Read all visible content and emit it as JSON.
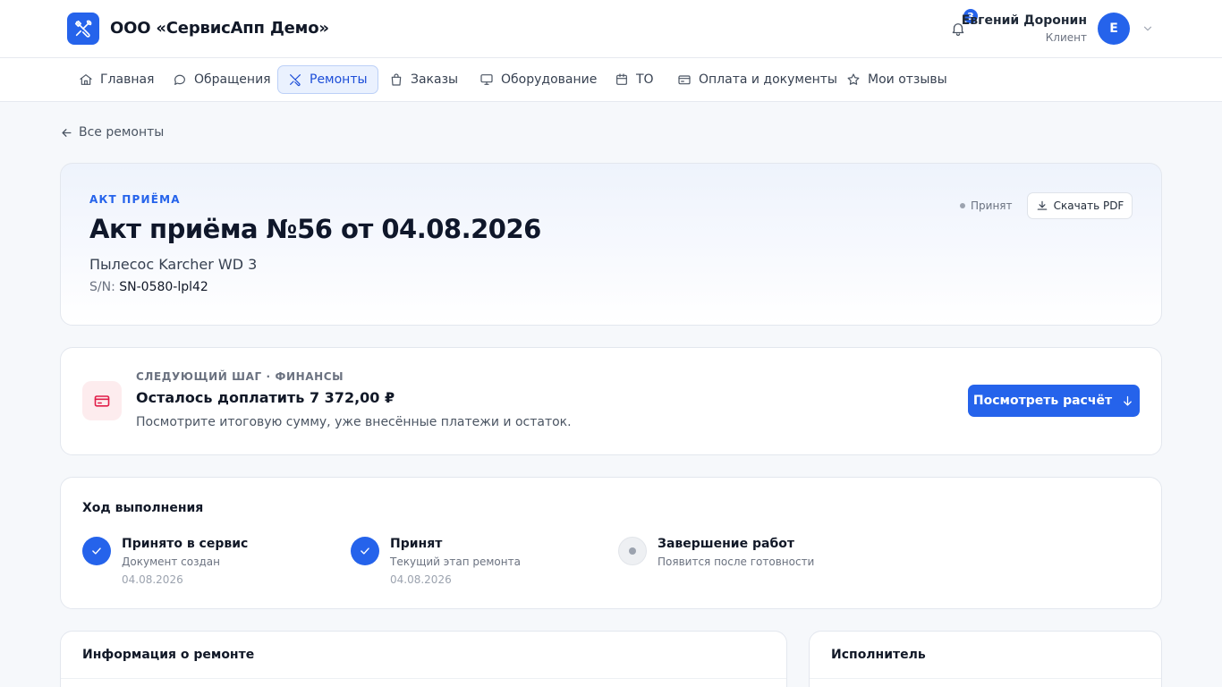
{
  "header": {
    "company": "ООО «СервисАпп Демо»",
    "notifications_count": "3",
    "user_name": "Евгений Доронин",
    "user_role": "Клиент",
    "avatar_letter": "E"
  },
  "nav": {
    "items": [
      {
        "label": "Главная",
        "icon": "home-icon"
      },
      {
        "label": "Обращения",
        "icon": "chat-icon"
      },
      {
        "label": "Ремонты",
        "icon": "tools-icon",
        "active": true
      },
      {
        "label": "Заказы",
        "icon": "bag-icon"
      },
      {
        "label": "Оборудование",
        "icon": "monitor-icon"
      },
      {
        "label": "ТО",
        "icon": "calendar-icon"
      },
      {
        "label": "Оплата и документы",
        "icon": "card-icon"
      },
      {
        "label": "Мои отзывы",
        "icon": "star-icon"
      }
    ]
  },
  "back_link": "Все ремонты",
  "document": {
    "eyebrow": "АКТ ПРИЁМА",
    "title": "Акт приёма №56 от 04.08.2026",
    "device": "Пылесос Karcher WD 3",
    "sn_label": "S/N:",
    "sn_value": "SN-0580-lpl42",
    "status": "Принят",
    "pdf_button": "Скачать PDF"
  },
  "next_step": {
    "eyebrow": "СЛЕДУЮЩИЙ ШАГ · ФИНАНСЫ",
    "title": "Осталось доплатить 7 372,00 ₽",
    "description": "Посмотрите итоговую сумму, уже внесённые платежи и остаток.",
    "button": "Посмотреть расчёт"
  },
  "progress": {
    "title": "Ход выполнения",
    "steps": [
      {
        "title": "Принято в сервис",
        "subtitle": "Документ создан",
        "date": "04.08.2026",
        "state": "done"
      },
      {
        "title": "Принят",
        "subtitle": "Текущий этап ремонта",
        "date": "04.08.2026",
        "state": "done"
      },
      {
        "title": "Завершение работ",
        "subtitle": "Появится после готовности",
        "date": "",
        "state": "pending"
      }
    ]
  },
  "info_card": {
    "title": "Информация о ремонте"
  },
  "executor_card": {
    "title": "Исполнитель"
  },
  "colors": {
    "accent": "#2563eb",
    "accent_light": "#eaf1fe",
    "danger_icon": "#e11d48"
  }
}
